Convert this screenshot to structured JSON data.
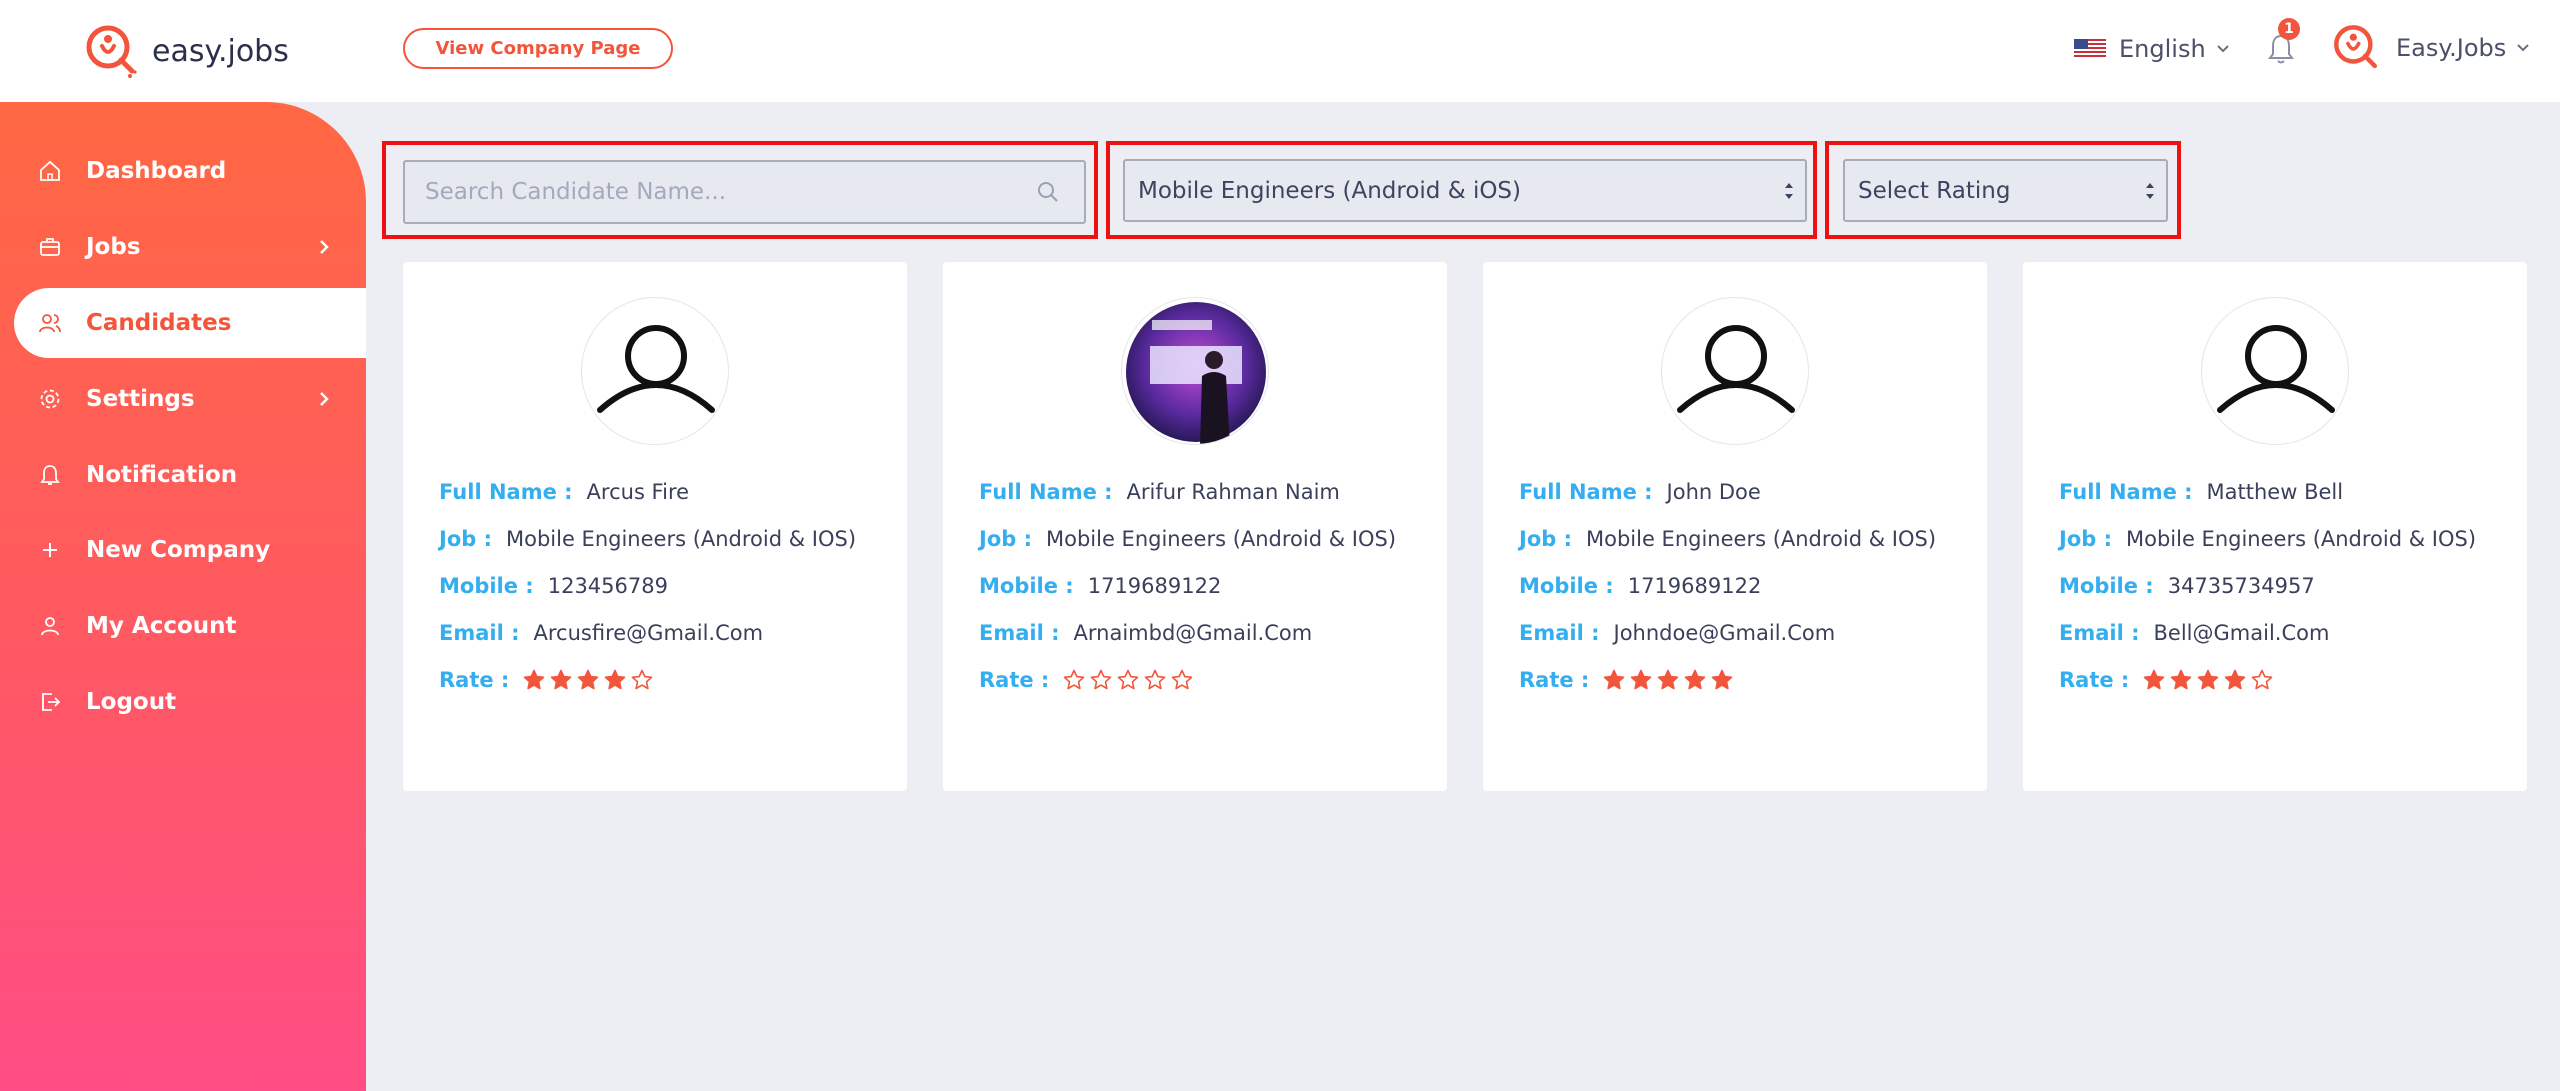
{
  "header": {
    "logo_text": "easy.jobs",
    "view_company_label": "View Company Page",
    "language": "English",
    "notification_count": "1",
    "account_name": "Easy.Jobs"
  },
  "sidebar": {
    "items": [
      {
        "label": "Dashboard",
        "icon": "home-icon"
      },
      {
        "label": "Jobs",
        "icon": "briefcase-icon",
        "has_submenu": true
      },
      {
        "label": "Candidates",
        "icon": "users-icon",
        "active": true
      },
      {
        "label": "Settings",
        "icon": "gear-icon",
        "has_submenu": true
      },
      {
        "label": "Notification",
        "icon": "bell-icon"
      },
      {
        "label": "New Company",
        "icon": "plus-icon"
      },
      {
        "label": "My Account",
        "icon": "user-icon"
      },
      {
        "label": "Logout",
        "icon": "logout-icon"
      }
    ]
  },
  "filters": {
    "search_placeholder": "Search Candidate Name...",
    "job_selected": "Mobile Engineers (Android & iOS)",
    "rating_selected": "Select Rating"
  },
  "labels": {
    "full_name": "Full Name :",
    "job": "Job :",
    "mobile": "Mobile :",
    "email": "Email :",
    "rate": "Rate :"
  },
  "candidates": [
    {
      "full_name": "Arcus Fire",
      "job": "Mobile Engineers (Android & IOS)",
      "mobile": "123456789",
      "email": "Arcusfire@Gmail.Com",
      "rating": 4,
      "avatar": "default-user-icon"
    },
    {
      "full_name": "Arifur Rahman Naim",
      "job": "Mobile Engineers (Android & IOS)",
      "mobile": "1719689122",
      "email": "Arnaimbd@Gmail.Com",
      "rating": 0,
      "avatar": "profile-photo"
    },
    {
      "full_name": "John Doe",
      "job": "Mobile Engineers (Android & IOS)",
      "mobile": "1719689122",
      "email": "Johndoe@Gmail.Com",
      "rating": 5,
      "avatar": "default-user-icon"
    },
    {
      "full_name": "Matthew Bell",
      "job": "Mobile Engineers (Android & IOS)",
      "mobile": "34735734957",
      "email": "Bell@Gmail.Com",
      "rating": 4,
      "avatar": "default-user-icon"
    }
  ],
  "colors": {
    "brand": "#f2553b",
    "label_blue": "#35aef0",
    "highlight_red": "#ee1111"
  }
}
